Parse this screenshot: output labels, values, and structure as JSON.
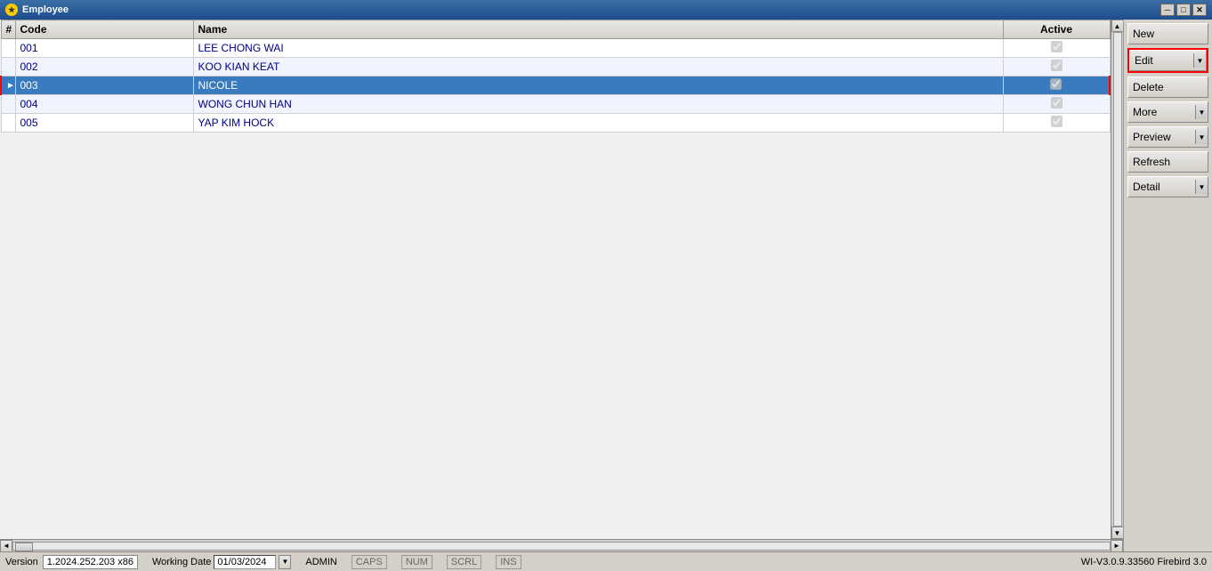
{
  "window": {
    "title": "Employee",
    "icon": "★"
  },
  "titlebar_controls": {
    "minimize": "─",
    "maximize": "□",
    "close": "✕"
  },
  "table": {
    "columns": [
      {
        "id": "hash",
        "label": "#",
        "key": "hash"
      },
      {
        "id": "code",
        "label": "Code",
        "key": "code"
      },
      {
        "id": "name",
        "label": "Name",
        "key": "name"
      },
      {
        "id": "active",
        "label": "Active",
        "key": "active"
      }
    ],
    "rows": [
      {
        "id": 1,
        "hash": "",
        "code": "001",
        "name": "LEE CHONG WAI",
        "active": true,
        "selected": false,
        "pointer": false
      },
      {
        "id": 2,
        "hash": "",
        "code": "002",
        "name": "KOO KIAN KEAT",
        "active": true,
        "selected": false,
        "pointer": false
      },
      {
        "id": 3,
        "hash": "",
        "code": "003",
        "name": "NICOLE",
        "active": true,
        "selected": true,
        "pointer": true
      },
      {
        "id": 4,
        "hash": "",
        "code": "004",
        "name": "WONG CHUN HAN",
        "active": true,
        "selected": false,
        "pointer": false
      },
      {
        "id": 5,
        "hash": "",
        "code": "005",
        "name": "YAP KIM HOCK",
        "active": true,
        "selected": false,
        "pointer": false
      }
    ]
  },
  "buttons": {
    "new_label": "New",
    "edit_label": "Edit",
    "delete_label": "Delete",
    "more_label": "More",
    "preview_label": "Preview",
    "refresh_label": "Refresh",
    "detail_label": "Detail",
    "dropdown_arrow": "▼"
  },
  "statusbar": {
    "version_label": "Version",
    "version_value": "1.2024.252.203 x86",
    "working_date_label": "Working Date",
    "working_date_value": "01/03/2024",
    "user_label": "ADMIN",
    "caps_label": "CAPS",
    "num_label": "NUM",
    "scrl_label": "SCRL",
    "ins_label": "INS",
    "version_info": "WI-V3.0.9.33560 Firebird 3.0"
  }
}
